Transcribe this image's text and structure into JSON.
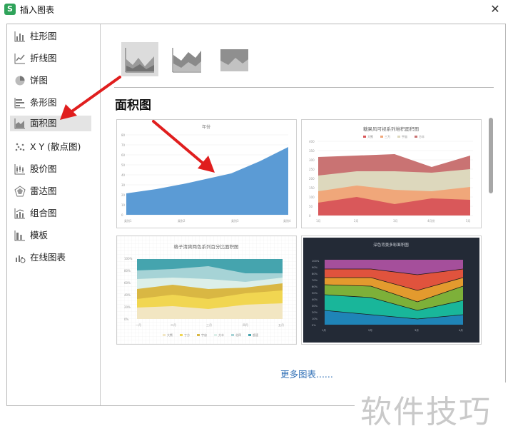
{
  "window": {
    "title": "插入图表",
    "app_icon": "S",
    "close_glyph": "✕"
  },
  "sidebar": {
    "items": [
      {
        "label": "柱形图",
        "icon": "column-chart-icon"
      },
      {
        "label": "折线图",
        "icon": "line-chart-icon"
      },
      {
        "label": "饼图",
        "icon": "pie-chart-icon"
      },
      {
        "label": "条形图",
        "icon": "bar-chart-icon"
      },
      {
        "label": "面积图",
        "icon": "area-chart-icon",
        "selected": true
      },
      {
        "label": "X Y (散点图)",
        "icon": "scatter-chart-icon"
      },
      {
        "label": "股价图",
        "icon": "stock-chart-icon"
      },
      {
        "label": "雷达图",
        "icon": "radar-chart-icon"
      },
      {
        "label": "组合图",
        "icon": "combo-chart-icon"
      },
      {
        "label": "模板",
        "icon": "template-icon"
      },
      {
        "label": "在线图表",
        "icon": "online-chart-icon"
      }
    ]
  },
  "main": {
    "section_title": "面积图",
    "more_link": "更多图表......",
    "templates": [
      {
        "title": "年份",
        "x_labels": [
          "类别1",
          "类别2",
          "类别3",
          "类别4"
        ],
        "y_labels": [
          "0",
          "10",
          "20",
          "30",
          "40",
          "50",
          "60",
          "70",
          "80"
        ]
      },
      {
        "title": "糖果风可视系列堆积面积图",
        "legend": [
          "大熊",
          "三万",
          "宇宙",
          "方丰"
        ],
        "x_labels": [
          "1月",
          "2月",
          "3月",
          "4月份",
          "5月"
        ],
        "y_labels": [
          "0",
          "50",
          "100",
          "150",
          "200",
          "250",
          "300",
          "350",
          "400"
        ]
      },
      {
        "title": "格子清爽两色系列百分比面积图",
        "legend": [
          "大熊",
          "丁方",
          "宇宙",
          "方丰",
          "北四",
          "超速"
        ],
        "x_labels": [
          "一月",
          "二月",
          "三月",
          "四月",
          "五月"
        ],
        "y_labels": [
          "0%",
          "20%",
          "40%",
          "60%",
          "80%",
          "100%"
        ]
      },
      {
        "title": "深色背景多彩面积图",
        "x_labels": [
          "1月",
          "2月",
          "3月",
          "4月"
        ],
        "y_labels": [
          "0%",
          "10%",
          "20%",
          "30%",
          "40%",
          "50%",
          "60%",
          "70%",
          "80%",
          "90%",
          "100%"
        ]
      }
    ]
  },
  "watermark": "软件技巧",
  "colors": {
    "selection": "#e4e4e4",
    "link": "#2f6fb6",
    "arrow": "#e01e1e",
    "area_blue": "#5b9bd5"
  }
}
